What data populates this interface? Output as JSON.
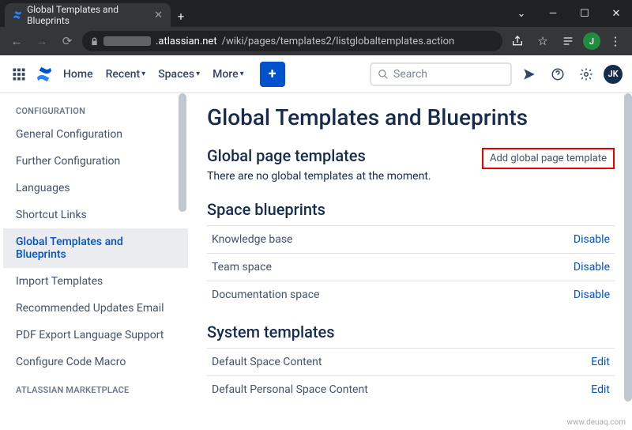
{
  "browser": {
    "tab_title": "Global Templates and Blueprints",
    "url_domain": ".atlassian.net",
    "url_path": "/wiki/pages/templates2/listglobaltemplates.action",
    "profile_initial": "J"
  },
  "header": {
    "nav": [
      "Home",
      "Recent",
      "Spaces",
      "More"
    ],
    "search_placeholder": "Search",
    "user_initials": "JK"
  },
  "sidebar": {
    "section1_title": "CONFIGURATION",
    "items1": [
      "General Configuration",
      "Further Configuration",
      "Languages",
      "Shortcut Links",
      "Global Templates and Blueprints",
      "Import Templates",
      "Recommended Updates Email",
      "PDF Export Language Support",
      "Configure Code Macro"
    ],
    "active_index": 4,
    "section2_title": "ATLASSIAN MARKETPLACE"
  },
  "main": {
    "title": "Global Templates and Blueprints",
    "global_templates_heading": "Global page templates",
    "add_button": "Add global page template",
    "empty_text": "There are no global templates at the moment.",
    "space_blueprints_heading": "Space blueprints",
    "space_blueprints": [
      {
        "name": "Knowledge base",
        "action": "Disable"
      },
      {
        "name": "Team space",
        "action": "Disable"
      },
      {
        "name": "Documentation space",
        "action": "Disable"
      }
    ],
    "system_templates_heading": "System templates",
    "system_templates": [
      {
        "name": "Default Space Content",
        "action": "Edit"
      },
      {
        "name": "Default Personal Space Content",
        "action": "Edit"
      }
    ]
  },
  "watermark": "www.deuaq.com"
}
